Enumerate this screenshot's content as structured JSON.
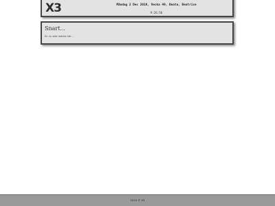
{
  "header": {
    "logo_text": "X3",
    "date_line": "Måndag 2 Dec 2019, Vecka 49, Beata, Beatrice",
    "time": "9:26:56"
  },
  "content": {
    "title": "Snart...",
    "text": "En ny sida laddas här..."
  },
  "footer": {
    "text": "2019 © X3"
  },
  "colors": {
    "panel_background": "#e3e3e3",
    "panel_border": "#444444",
    "footer_background": "#9a9a9a",
    "page_background": "#ffffff"
  }
}
